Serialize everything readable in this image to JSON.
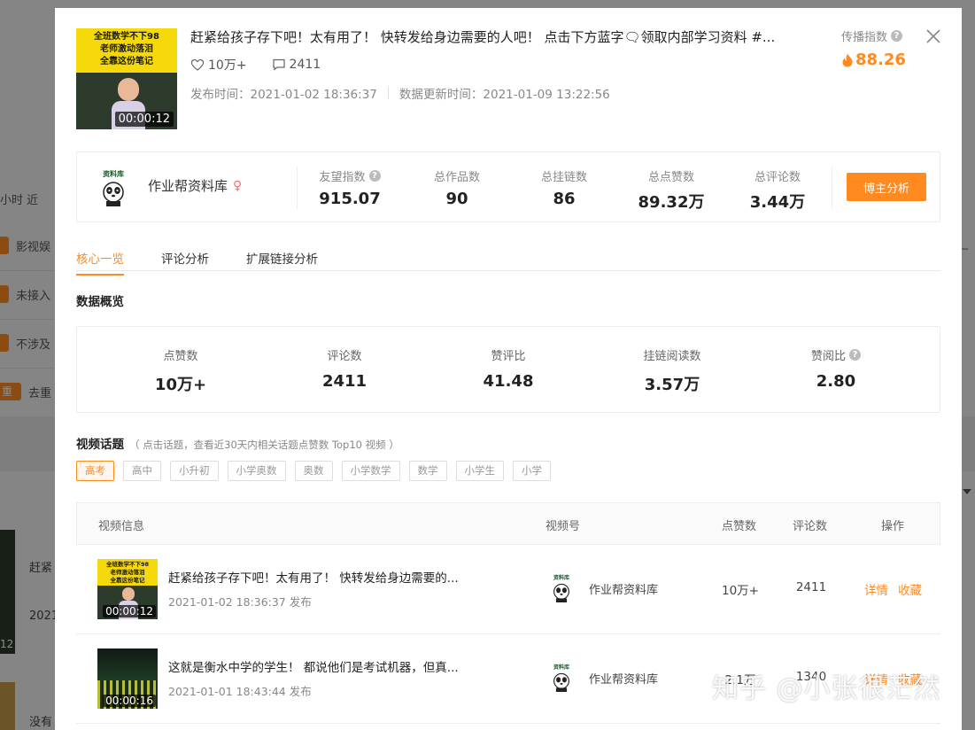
{
  "background": {
    "filter_text": "小时  近",
    "tag_rows": [
      {
        "tag": "",
        "label": "影视娱"
      },
      {
        "tag": "",
        "label": "未接入"
      },
      {
        "tag": "",
        "label": "不涉及"
      },
      {
        "tag": "重",
        "label": "去重"
      }
    ],
    "row_text_1": "赶紧",
    "row_date_1": "2021",
    "row_duration_1": "12",
    "row_text_2": "没有"
  },
  "video": {
    "title": "赶紧给孩子存下吧！太有用了！ 快转发给身边需要的人吧！ 点击下方蓝字🗨领取内部学习资料 #...",
    "thumb_banner_lines": [
      "全班数学不下98",
      "老师激动落泪",
      "全靠这份笔记"
    ],
    "duration": "00:00:12",
    "likes": "10万+",
    "comments": "2411",
    "publish_time": "发布时间：2021-01-02 18:36:37",
    "update_time": "数据更新时间：2021-01-09 13:22:56",
    "spread_label": "传播指数",
    "spread_value": "88.26"
  },
  "author": {
    "name": "作业帮资料库",
    "gender_icon": "♀",
    "metrics": [
      {
        "label": "友望指数",
        "value": "915.07",
        "help": true
      },
      {
        "label": "总作品数",
        "value": "90",
        "help": false
      },
      {
        "label": "总挂链数",
        "value": "86",
        "help": false
      },
      {
        "label": "总点赞数",
        "value": "89.32万",
        "help": false
      },
      {
        "label": "总评论数",
        "value": "3.44万",
        "help": false
      }
    ],
    "button": "博主分析"
  },
  "tabs": [
    "核心一览",
    "评论分析",
    "扩展链接分析"
  ],
  "overview_title": "数据概览",
  "overview": [
    {
      "label": "点赞数",
      "value": "10万+",
      "help": false
    },
    {
      "label": "评论数",
      "value": "2411",
      "help": false
    },
    {
      "label": "赞评比",
      "value": "41.48",
      "help": false
    },
    {
      "label": "挂链阅读数",
      "value": "3.57万",
      "help": false
    },
    {
      "label": "赞阅比",
      "value": "2.80",
      "help": true
    }
  ],
  "topics": {
    "title": "视频话题",
    "hint": "（ 点击话题，查看近30天内相关话题点赞数 Top10 视频 ）",
    "tags": [
      "高考",
      "高中",
      "小升初",
      "小学奥数",
      "奥数",
      "小学数学",
      "数学",
      "小学生",
      "小学"
    ]
  },
  "table": {
    "headers": [
      "视频信息",
      "视频号",
      "点赞数",
      "评论数",
      "操作"
    ],
    "rows": [
      {
        "title": "赶紧给孩子存下吧！太有用了！ 快转发给身边需要的...",
        "published": "2021-01-02 18:36:37 发布",
        "duration": "00:00:12",
        "thumb_banner_lines": [
          "全班数学不下98",
          "老师激动落泪",
          "全靠这份笔记"
        ],
        "author": "作业帮资料库",
        "likes": "10万+",
        "comments": "2411",
        "action_detail": "详情",
        "action_fav": "收藏"
      },
      {
        "title": "这就是衡水中学的学生！ 都说他们是考试机器，但真...",
        "published": "2021-01-01 18:43:44 发布",
        "duration": "00:00:16",
        "author": "作业帮资料库",
        "likes": "2.1万",
        "comments": "1340",
        "action_detail": "详情",
        "action_fav": "收藏"
      }
    ]
  },
  "avatar_text": "资料库",
  "watermark": "知乎 @小张很茫然",
  "colors": {
    "accent": "#ff8a20",
    "help_gray": "#bbbbbb"
  }
}
